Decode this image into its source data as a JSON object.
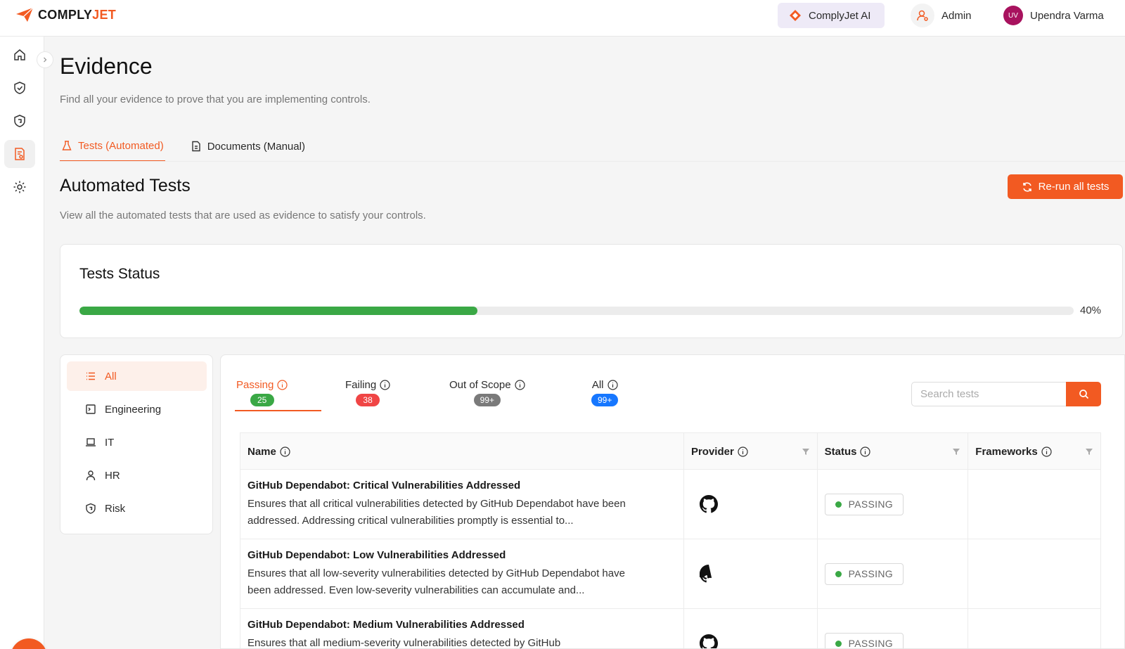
{
  "header": {
    "logo_prefix": "COMPLY",
    "logo_suffix": "JET",
    "ai_label": "ComplyJet AI",
    "role_label": "Admin",
    "user_initials": "UV",
    "user_name": "Upendra Varma"
  },
  "page": {
    "title": "Evidence",
    "subtitle": "Find all your evidence to prove that you are implementing controls.",
    "tabs": [
      {
        "label": "Tests (Automated)",
        "active": true
      },
      {
        "label": "Documents (Manual)",
        "active": false
      }
    ]
  },
  "section": {
    "title": "Automated Tests",
    "subtitle": "View all the automated tests that are used as evidence to satisfy your controls.",
    "rerun_label": "Re-run all tests"
  },
  "status": {
    "title": "Tests Status",
    "progress": 0.4,
    "progress_label": "40%"
  },
  "categories": [
    {
      "label": "All",
      "icon": "list-icon",
      "active": true
    },
    {
      "label": "Engineering",
      "icon": "terminal-icon",
      "active": false
    },
    {
      "label": "IT",
      "icon": "laptop-icon",
      "active": false
    },
    {
      "label": "HR",
      "icon": "user-icon",
      "active": false
    },
    {
      "label": "Risk",
      "icon": "shield-icon",
      "active": false
    }
  ],
  "filters": [
    {
      "label": "Passing",
      "count": "25",
      "color": "#3aa845",
      "active": true
    },
    {
      "label": "Failing",
      "count": "38",
      "color": "#f04545",
      "active": false
    },
    {
      "label": "Out of Scope",
      "count": "99+",
      "color": "#7a7a7a",
      "active": false
    },
    {
      "label": "All",
      "count": "99+",
      "color": "#1677ff",
      "active": false
    }
  ],
  "search": {
    "placeholder": "Search tests"
  },
  "table": {
    "columns": [
      "Name",
      "Provider",
      "Status",
      "Frameworks"
    ],
    "rows": [
      {
        "name": "GitHub Dependabot: Critical Vulnerabilities Addressed",
        "description": "Ensures that all critical vulnerabilities detected by GitHub Dependabot have been addressed. Addressing critical vulnerabilities promptly is essential to...",
        "provider": "github-icon",
        "status": "PASSING"
      },
      {
        "name": "GitHub Dependabot: Low Vulnerabilities Addressed",
        "description": "Ensures that all low-severity vulnerabilities detected by GitHub Dependabot have been addressed. Even low-severity vulnerabilities can accumulate and...",
        "provider": "github-icon",
        "status": "PASSING"
      },
      {
        "name": "GitHub Dependabot: Medium Vulnerabilities Addressed",
        "description": "Ensures that all medium-severity vulnerabilities detected by GitHub",
        "provider": "github-icon",
        "status": "PASSING"
      }
    ]
  },
  "colors": {
    "accent": "#f25a22",
    "success": "#3aa845"
  }
}
